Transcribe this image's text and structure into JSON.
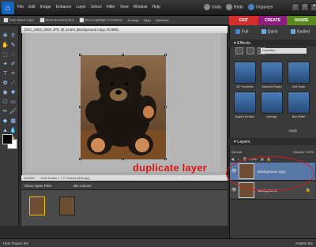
{
  "menu": [
    "File",
    "Edit",
    "Image",
    "Enhance",
    "Layer",
    "Select",
    "Filter",
    "View",
    "Window",
    "Help"
  ],
  "undo": {
    "undo": "Undo",
    "redo": "Redo",
    "organizer": "Organizer"
  },
  "options": [
    "Auto Select Layer",
    "Show Bounding Box",
    "Show Highlight on Rollover",
    "Arrange",
    "Align",
    "Distribute"
  ],
  "document": {
    "title": "DSC_0002_0002.JPG @ 13.5% (Background copy, RGB/8)",
    "zoom": "13.54%",
    "size": "6.22 inches x 7.77 inches (300 ppi)"
  },
  "caption": "duplicate layer",
  "bin": {
    "show_open_files": "Show Open Files",
    "bin_actions": "Bin Actions"
  },
  "bottom": {
    "left": "Hide Project Bin",
    "right": "Palette Bin"
  },
  "modes": [
    "EDIT",
    "CREATE",
    "SHARE"
  ],
  "submodes": [
    "Full",
    "Quick",
    "Guided"
  ],
  "effects": {
    "title": "Effects",
    "dropdown": "Favorites",
    "apply": "Apply",
    "items": [
      "3D Transform",
      "Assorted Edges",
      "Add Noise",
      "Angled Strokes",
      "Average",
      "Bas Relief"
    ]
  },
  "layers": {
    "title": "Layers",
    "blend": "Normal",
    "opacity_label": "Opacity:",
    "opacity": "100%",
    "lock_label": "Lock:",
    "items": [
      "Background copy",
      "Background"
    ]
  },
  "colors": {
    "edit": "#d32f2f",
    "create": "#8e1e7e",
    "share": "#5a8a1e",
    "annotation": "#d21a1a"
  }
}
